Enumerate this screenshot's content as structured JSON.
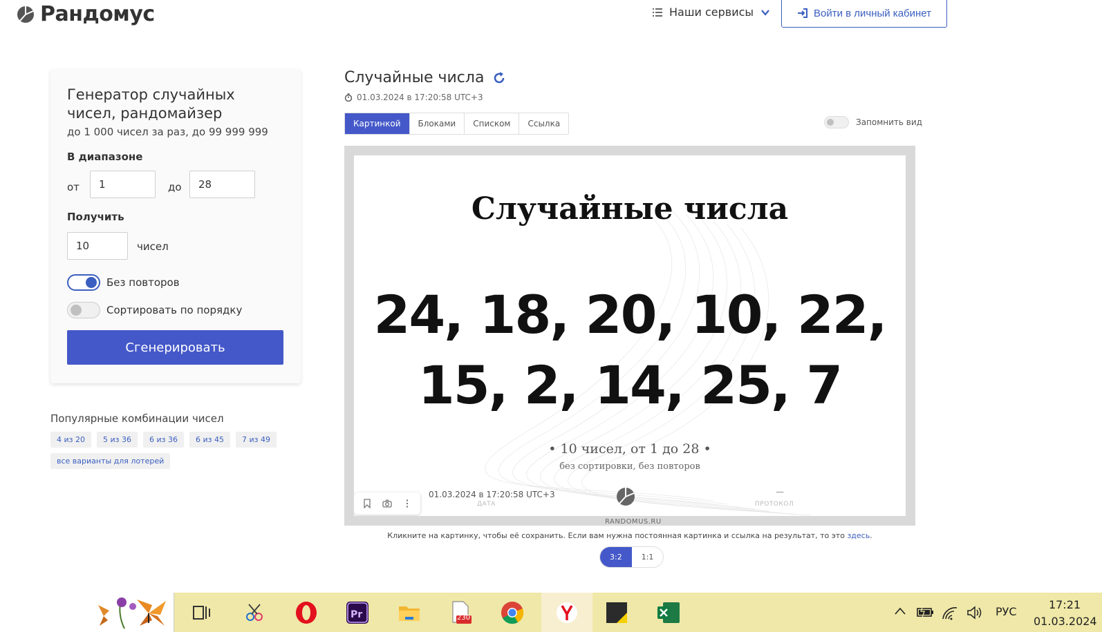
{
  "header": {
    "brand": "Рандомус",
    "services_label": "Наши сервисы",
    "login_label": "Войти в личный кабинет"
  },
  "generator": {
    "title": "Генератор случайных чисел, рандомайзер",
    "subtitle": "до 1 000 чисел за раз, до 99 999 999",
    "range_label": "В диапазоне",
    "from_label": "от",
    "from_value": "1",
    "to_label": "до",
    "to_value": "28",
    "get_label": "Получить",
    "count_value": "10",
    "count_suffix": "чисел",
    "no_repeat_label": "Без повторов",
    "no_repeat_on": true,
    "sort_label": "Сортировать по порядку",
    "sort_on": false,
    "generate_label": "Сгенерировать"
  },
  "popular": {
    "title": "Популярные комбинации чисел",
    "chips": [
      "4 из 20",
      "5 из 36",
      "6 из 36",
      "6 из 45",
      "7 из 49",
      "все варианты для лотерей"
    ]
  },
  "result": {
    "title": "Случайные числа",
    "timestamp": "01.03.2024 в 17:20:58 UTC+3",
    "tabs": [
      {
        "label": "Картинкой",
        "active": true
      },
      {
        "label": "Блоками",
        "active": false
      },
      {
        "label": "Списком",
        "active": false
      },
      {
        "label": "Ссылка",
        "active": false
      }
    ],
    "remember_label": "Запомнить вид",
    "card": {
      "heading": "Случайные числа",
      "numbers_line1": "24, 18, 20, 10, 22,",
      "numbers_line2": "15, 2, 14, 25, 7",
      "summary": "•  10 чисел, от 1 до 28  •",
      "summary_sub": "без сортировки, без повторов",
      "date": "01.03.2024 в 17:20:58 UTC+3",
      "date_caption": "ДАТА",
      "protocol_dash": "—",
      "protocol_caption": "ПРОТОКОЛ",
      "site": "RANDOMUS.RU"
    },
    "hint_text": "Кликните на картинку, чтобы её сохранить. Если вам нужна постоянная картинка и ссылка на результат, то это ",
    "hint_link": "здесь",
    "hint_end": ".",
    "ratios": [
      {
        "label": "3:2",
        "active": true
      },
      {
        "label": "1:1",
        "active": false
      }
    ]
  },
  "taskbar": {
    "badge": "230",
    "lang": "РУС",
    "time": "17:21",
    "date": "01.03.2024"
  },
  "colors": {
    "accent": "#4458c9",
    "link": "#3b5fc0",
    "taskbar": "#efe8a8"
  }
}
